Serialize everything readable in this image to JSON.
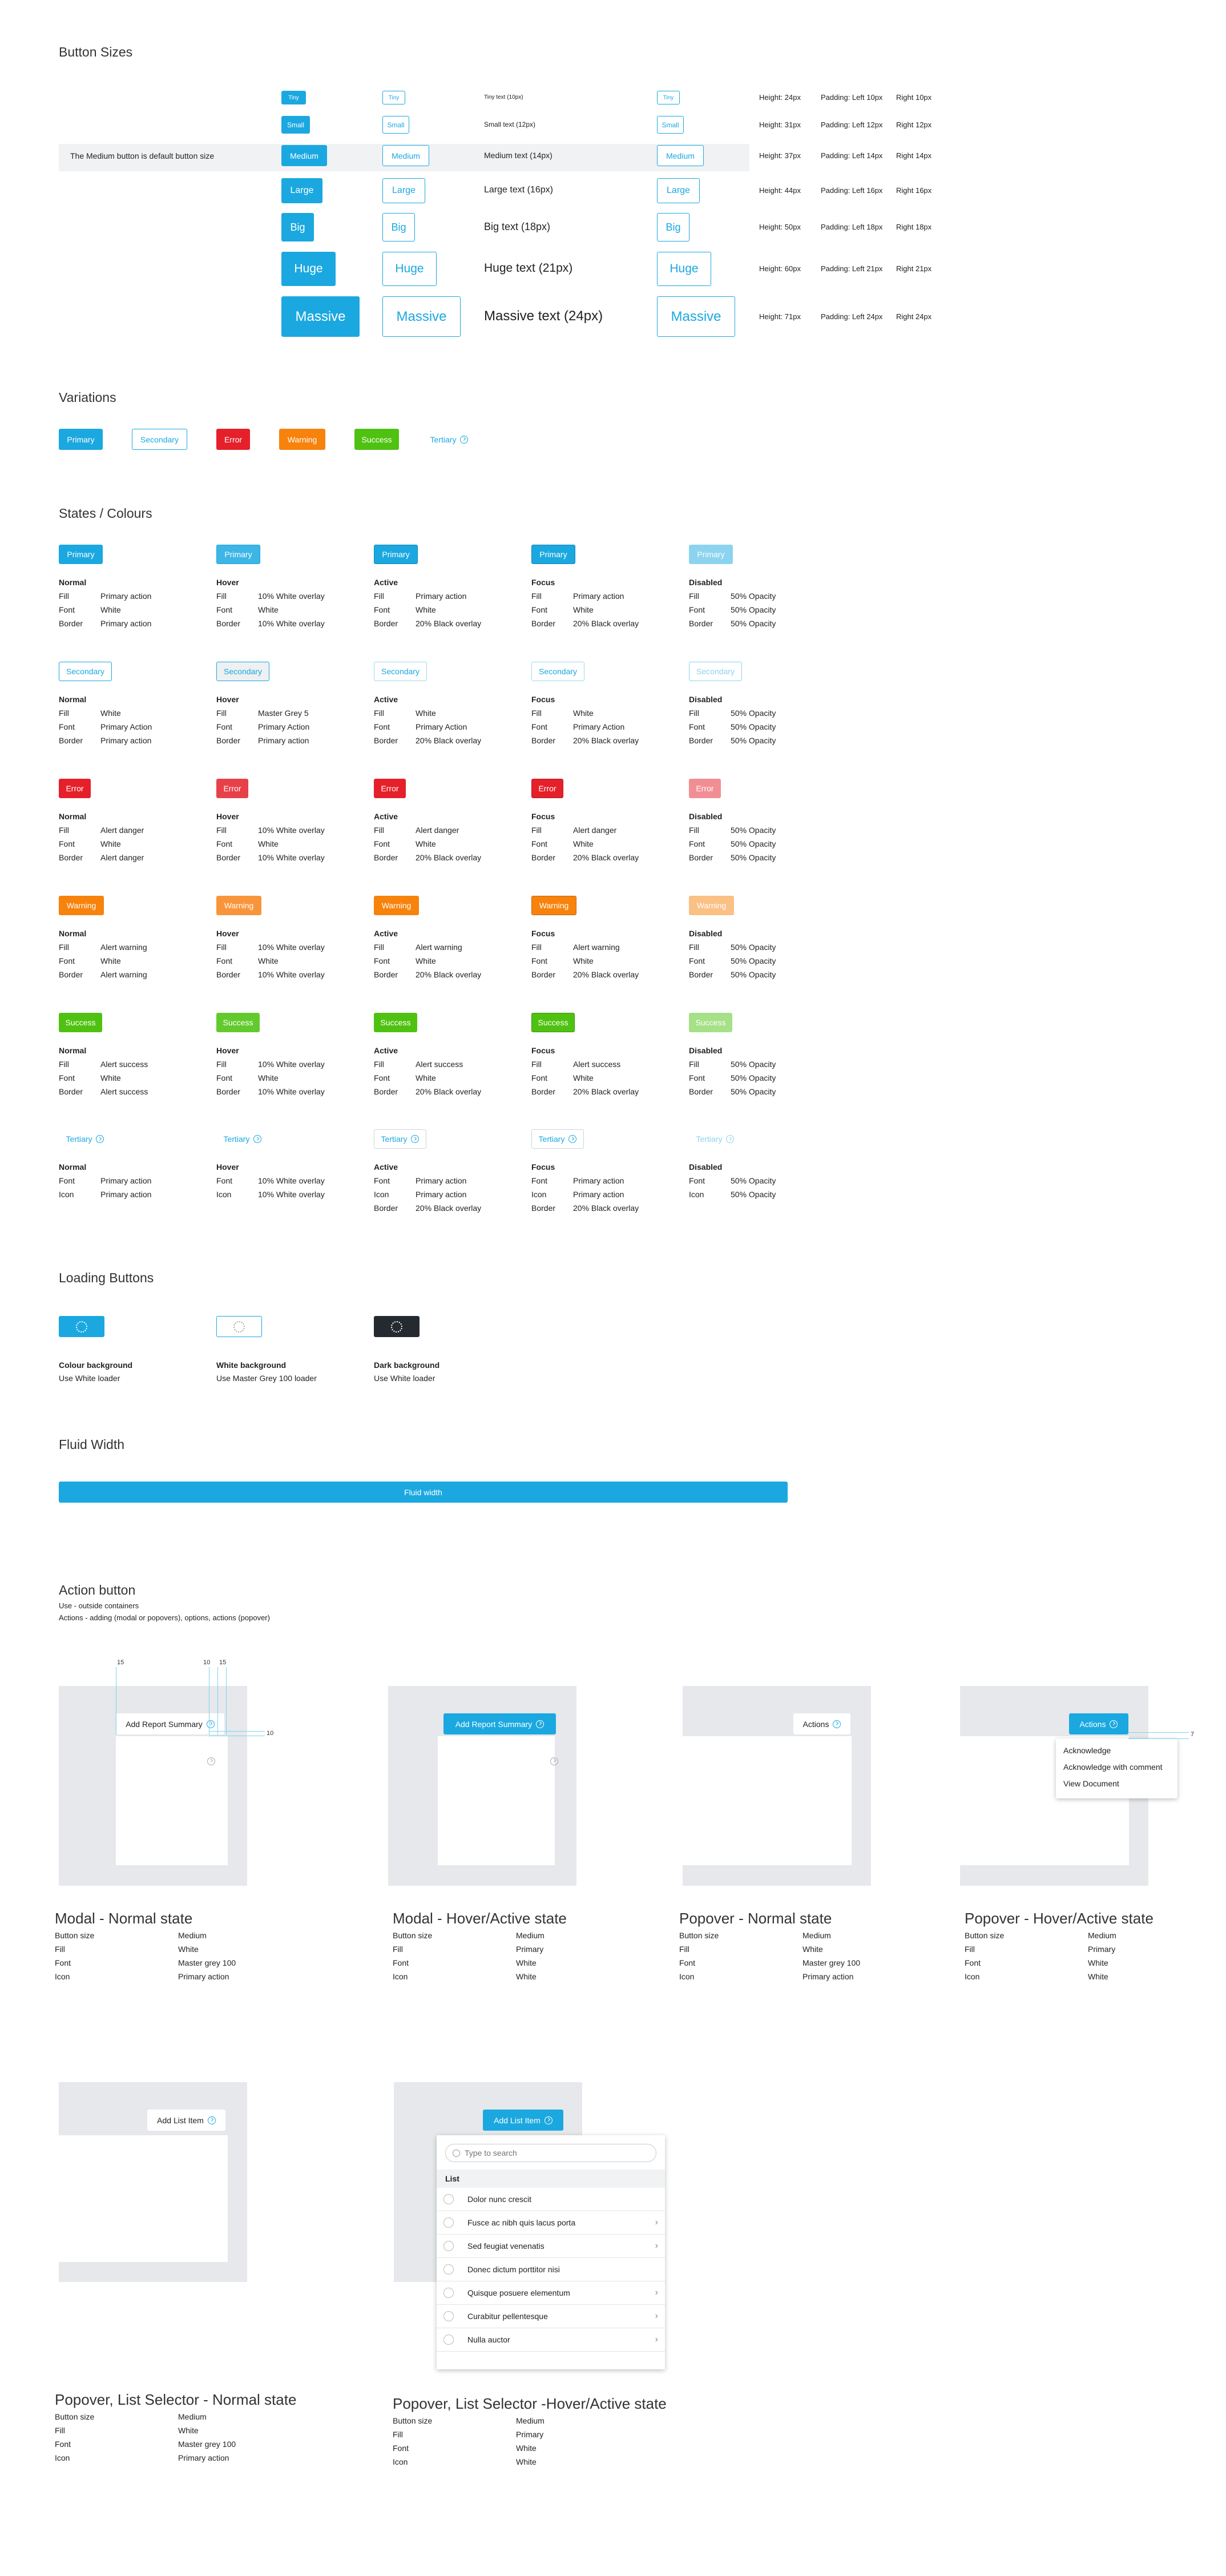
{
  "colors": {
    "primary": "#1ba8e0",
    "error": "#e5202a",
    "warning": "#f7820c",
    "success": "#4fc211",
    "dark": "#242a30",
    "panel": "#e6e8eb"
  },
  "sizes": {
    "title": "Button Sizes",
    "default_note": "The Medium button is default button size",
    "rows": [
      {
        "primary": "Tiny",
        "secondary": "Tiny",
        "text": "Tiny text (10px)",
        "tertiary": "Tiny",
        "height": "Height: 24px",
        "pl": "Padding: Left 10px",
        "pr": "Right 10px"
      },
      {
        "primary": "Small",
        "secondary": "Small",
        "text": "Small text (12px)",
        "tertiary": "Small",
        "height": "Height: 31px",
        "pl": "Padding: Left 12px",
        "pr": "Right 12px"
      },
      {
        "primary": "Medium",
        "secondary": "Medium",
        "text": "Medium text (14px)",
        "tertiary": "Medium",
        "height": "Height: 37px",
        "pl": "Padding: Left 14px",
        "pr": "Right 14px"
      },
      {
        "primary": "Large",
        "secondary": "Large",
        "text": "Large text (16px)",
        "tertiary": "Large",
        "height": "Height: 44px",
        "pl": "Padding: Left 16px",
        "pr": "Right 16px"
      },
      {
        "primary": "Big",
        "secondary": "Big",
        "text": "Big text (18px)",
        "tertiary": "Big",
        "height": "Height: 50px",
        "pl": "Padding: Left 18px",
        "pr": "Right 18px"
      },
      {
        "primary": "Huge",
        "secondary": "Huge",
        "text": "Huge text (21px)",
        "tertiary": "Huge",
        "height": "Height: 60px",
        "pl": "Padding: Left 21px",
        "pr": "Right 21px"
      },
      {
        "primary": "Massive",
        "secondary": "Massive",
        "text": "Massive text (24px)",
        "tertiary": "Massive",
        "height": "Height: 71px",
        "pl": "Padding: Left 24px",
        "pr": "Right 24px"
      }
    ]
  },
  "variations": {
    "title": "Variations",
    "primary": "Primary",
    "secondary": "Secondary",
    "error": "Error",
    "warning": "Warning",
    "success": "Success",
    "tertiary": "Tertiary"
  },
  "states": {
    "title": "States / Colours",
    "primary": [
      {
        "label": "Primary",
        "state": "Normal",
        "rows": [
          [
            "Fill",
            "Primary action"
          ],
          [
            "Font",
            "White"
          ],
          [
            "Border",
            "Primary action"
          ]
        ]
      },
      {
        "label": "Primary",
        "state": "Hover",
        "rows": [
          [
            "Fill",
            "10% White overlay"
          ],
          [
            "Font",
            "White"
          ],
          [
            "Border",
            "10% White overlay"
          ]
        ]
      },
      {
        "label": "Primary",
        "state": "Active",
        "rows": [
          [
            "Fill",
            "Primary action"
          ],
          [
            "Font",
            "White"
          ],
          [
            "Border",
            "20% Black overlay"
          ]
        ]
      },
      {
        "label": "Primary",
        "state": "Focus",
        "rows": [
          [
            "Fill",
            "Primary action"
          ],
          [
            "Font",
            "White"
          ],
          [
            "Border",
            "20% Black overlay"
          ]
        ]
      },
      {
        "label": "Primary",
        "state": "Disabled",
        "rows": [
          [
            "Fill",
            "50% Opacity"
          ],
          [
            "Font",
            "50% Opacity"
          ],
          [
            "Border",
            "50% Opacity"
          ]
        ]
      }
    ],
    "secondary": [
      {
        "label": "Secondary",
        "state": "Normal",
        "rows": [
          [
            "Fill",
            "White"
          ],
          [
            "Font",
            "Primary Action"
          ],
          [
            "Border",
            "Primary action"
          ]
        ]
      },
      {
        "label": "Secondary",
        "state": "Hover",
        "rows": [
          [
            "Fill",
            "Master Grey 5"
          ],
          [
            "Font",
            "Primary Action"
          ],
          [
            "Border",
            "Primary action"
          ]
        ]
      },
      {
        "label": "Secondary",
        "state": "Active",
        "rows": [
          [
            "Fill",
            "White"
          ],
          [
            "Font",
            "Primary Action"
          ],
          [
            "Border",
            "20% Black overlay"
          ]
        ]
      },
      {
        "label": "Secondary",
        "state": "Focus",
        "rows": [
          [
            "Fill",
            "White"
          ],
          [
            "Font",
            "Primary Action"
          ],
          [
            "Border",
            "20% Black overlay"
          ]
        ]
      },
      {
        "label": "Secondary",
        "state": "Disabled",
        "rows": [
          [
            "Fill",
            "50% Opacity"
          ],
          [
            "Font",
            "50% Opacity"
          ],
          [
            "Border",
            "50% Opacity"
          ]
        ]
      }
    ],
    "error": [
      {
        "label": "Error",
        "state": "Normal",
        "rows": [
          [
            "Fill",
            "Alert danger"
          ],
          [
            "Font",
            "White"
          ],
          [
            "Border",
            "Alert danger"
          ]
        ]
      },
      {
        "label": "Error",
        "state": "Hover",
        "rows": [
          [
            "Fill",
            "10% White overlay"
          ],
          [
            "Font",
            "White"
          ],
          [
            "Border",
            "10% White overlay"
          ]
        ]
      },
      {
        "label": "Error",
        "state": "Active",
        "rows": [
          [
            "Fill",
            "Alert danger"
          ],
          [
            "Font",
            "White"
          ],
          [
            "Border",
            "20% Black overlay"
          ]
        ]
      },
      {
        "label": "Error",
        "state": "Focus",
        "rows": [
          [
            "Fill",
            "Alert danger"
          ],
          [
            "Font",
            "White"
          ],
          [
            "Border",
            "20% Black overlay"
          ]
        ]
      },
      {
        "label": "Error",
        "state": "Disabled",
        "rows": [
          [
            "Fill",
            "50% Opacity"
          ],
          [
            "Font",
            "50% Opacity"
          ],
          [
            "Border",
            "50% Opacity"
          ]
        ]
      }
    ],
    "warning": [
      {
        "label": "Warning",
        "state": "Normal",
        "rows": [
          [
            "Fill",
            "Alert warning"
          ],
          [
            "Font",
            "White"
          ],
          [
            "Border",
            "Alert warning"
          ]
        ]
      },
      {
        "label": "Warning",
        "state": "Hover",
        "rows": [
          [
            "Fill",
            "10% White overlay"
          ],
          [
            "Font",
            "White"
          ],
          [
            "Border",
            "10% White overlay"
          ]
        ]
      },
      {
        "label": "Warning",
        "state": "Active",
        "rows": [
          [
            "Fill",
            "Alert warning"
          ],
          [
            "Font",
            "White"
          ],
          [
            "Border",
            "20% Black overlay"
          ]
        ]
      },
      {
        "label": "Warning",
        "state": "Focus",
        "rows": [
          [
            "Fill",
            "Alert warning"
          ],
          [
            "Font",
            "White"
          ],
          [
            "Border",
            "20% Black overlay"
          ]
        ]
      },
      {
        "label": "Warning",
        "state": "Disabled",
        "rows": [
          [
            "Fill",
            "50% Opacity"
          ],
          [
            "Font",
            "50% Opacity"
          ],
          [
            "Border",
            "50% Opacity"
          ]
        ]
      }
    ],
    "success": [
      {
        "label": "Success",
        "state": "Normal",
        "rows": [
          [
            "Fill",
            "Alert success"
          ],
          [
            "Font",
            "White"
          ],
          [
            "Border",
            "Alert success"
          ]
        ]
      },
      {
        "label": "Success",
        "state": "Hover",
        "rows": [
          [
            "Fill",
            "10% White overlay"
          ],
          [
            "Font",
            "White"
          ],
          [
            "Border",
            "10% White overlay"
          ]
        ]
      },
      {
        "label": "Success",
        "state": "Active",
        "rows": [
          [
            "Fill",
            "Alert success"
          ],
          [
            "Font",
            "White"
          ],
          [
            "Border",
            "20% Black overlay"
          ]
        ]
      },
      {
        "label": "Success",
        "state": "Focus",
        "rows": [
          [
            "Fill",
            "Alert success"
          ],
          [
            "Font",
            "White"
          ],
          [
            "Border",
            "20% Black overlay"
          ]
        ]
      },
      {
        "label": "Success",
        "state": "Disabled",
        "rows": [
          [
            "Fill",
            "50% Opacity"
          ],
          [
            "Font",
            "50% Opacity"
          ],
          [
            "Border",
            "50% Opacity"
          ]
        ]
      }
    ],
    "tertiary": [
      {
        "label": "Tertiary",
        "state": "Normal",
        "rows": [
          [
            "Font",
            "Primary action"
          ],
          [
            "Icon",
            "Primary action"
          ]
        ]
      },
      {
        "label": "Tertiary",
        "state": "Hover",
        "rows": [
          [
            "Font",
            "10% White overlay"
          ],
          [
            "Icon",
            "10% White overlay"
          ]
        ]
      },
      {
        "label": "Tertiary",
        "state": "Active",
        "rows": [
          [
            "Font",
            "Primary action"
          ],
          [
            "Icon",
            "Primary action"
          ],
          [
            "Border",
            "20% Black overlay"
          ]
        ]
      },
      {
        "label": "Tertiary",
        "state": "Focus",
        "rows": [
          [
            "Font",
            "Primary action"
          ],
          [
            "Icon",
            "Primary action"
          ],
          [
            "Border",
            "20% Black overlay"
          ]
        ]
      },
      {
        "label": "Tertiary",
        "state": "Disabled",
        "rows": [
          [
            "Font",
            "50% Opacity"
          ],
          [
            "Icon",
            "50% Opacity"
          ]
        ]
      }
    ]
  },
  "loading": {
    "title": "Loading Buttons",
    "items": [
      {
        "title": "Colour background",
        "desc": "Use White loader"
      },
      {
        "title": "White background",
        "desc": "Use Master Grey 100 loader"
      },
      {
        "title": "Dark background",
        "desc": "Use White loader"
      }
    ]
  },
  "fluid": {
    "title": "Fluid Width",
    "label": "Fluid width"
  },
  "action": {
    "title": "Action button",
    "desc1": "Use - outside containers",
    "desc2": "Actions - adding (modal or popovers), options, actions (popover)",
    "ann": {
      "a": "15",
      "b": "10",
      "c": "15",
      "d": "10",
      "e": "7"
    },
    "add_report": "Add Report Summary",
    "actions_label": "Actions",
    "menu": [
      "Acknowledge",
      "Acknowledge with comment",
      "View Document"
    ],
    "cards": [
      {
        "title": "Modal - Normal state",
        "rows": [
          [
            "Button size",
            "Medium"
          ],
          [
            "Fill",
            "White"
          ],
          [
            "Font",
            "Master grey 100"
          ],
          [
            "Icon",
            "Primary action"
          ]
        ]
      },
      {
        "title": "Modal - Hover/Active state",
        "rows": [
          [
            "Button size",
            "Medium"
          ],
          [
            "Fill",
            "Primary"
          ],
          [
            "Font",
            "White"
          ],
          [
            "Icon",
            "White"
          ]
        ]
      },
      {
        "title": "Popover - Normal state",
        "rows": [
          [
            "Button size",
            "Medium"
          ],
          [
            "Fill",
            "White"
          ],
          [
            "Font",
            "Master grey 100"
          ],
          [
            "Icon",
            "Primary action"
          ]
        ]
      },
      {
        "title": "Popover - Hover/Active state",
        "rows": [
          [
            "Button size",
            "Medium"
          ],
          [
            "Fill",
            "Primary"
          ],
          [
            "Font",
            "White"
          ],
          [
            "Icon",
            "White"
          ]
        ]
      }
    ],
    "list_cards": [
      {
        "title": "Popover, List Selector - Normal state",
        "rows": [
          [
            "Button size",
            "Medium"
          ],
          [
            "Fill",
            "White"
          ],
          [
            "Font",
            "Master grey 100"
          ],
          [
            "Icon",
            "Primary action"
          ]
        ]
      },
      {
        "title": "Popover, List Selector -Hover/Active state",
        "rows": [
          [
            "Button size",
            "Medium"
          ],
          [
            "Fill",
            "Primary"
          ],
          [
            "Font",
            "White"
          ],
          [
            "Icon",
            "White"
          ]
        ]
      }
    ],
    "add_list": "Add List Item",
    "search_placeholder": "Type to search",
    "list_header": "List",
    "list_items": [
      {
        "label": "Dolor nunc crescit",
        "chevron": false
      },
      {
        "label": "Fusce ac nibh quis lacus porta",
        "chevron": true
      },
      {
        "label": "Sed feugiat venenatis",
        "chevron": true
      },
      {
        "label": "Donec dictum porttitor nisi",
        "chevron": false
      },
      {
        "label": "Quisque posuere elementum",
        "chevron": true
      },
      {
        "label": "Curabitur pellentesque",
        "chevron": true
      },
      {
        "label": "Nulla auctor",
        "chevron": true
      }
    ]
  }
}
